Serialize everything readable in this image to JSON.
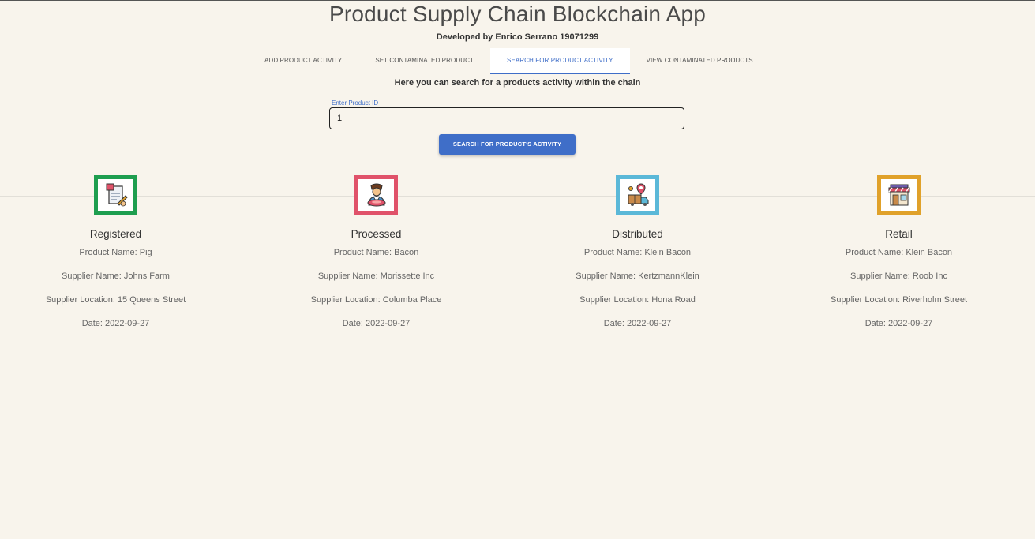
{
  "app": {
    "title": "Product Supply Chain Blockchain App",
    "subtitle": "Developed by Enrico Serrano 19071299"
  },
  "tabs": [
    {
      "label": "ADD PRODUCT ACTIVITY"
    },
    {
      "label": "SET CONTAMINATED PRODUCT"
    },
    {
      "label": "SEARCH FOR PRODUCT ACTIVITY",
      "active": true
    },
    {
      "label": "VIEW CONTAMINATED PRODUCTS"
    }
  ],
  "search": {
    "intro": "Here you can search for a products activity within the chain",
    "label": "Enter Product ID",
    "value": "1",
    "button_label": "SEARCH FOR PRODUCT'S ACTIVITY"
  },
  "colors": {
    "accent": "#3f6ec8",
    "registered": "#1e9e4f",
    "processed": "#e0526a",
    "distributed": "#5bb8d8",
    "retail": "#e0a12a"
  },
  "stages": [
    {
      "icon": "document-signing-icon",
      "title": "Registered",
      "product": "Product Name: Pig",
      "supplier": "Supplier Name: Johns Farm",
      "location": "Supplier Location: 15 Queens Street",
      "date": "Date: 2022-09-27"
    },
    {
      "icon": "butcher-icon",
      "title": "Processed",
      "product": "Product Name: Bacon",
      "supplier": "Supplier Name: Morissette Inc",
      "location": "Supplier Location: Columba Place",
      "date": "Date: 2022-09-27"
    },
    {
      "icon": "delivery-location-icon",
      "title": "Distributed",
      "product": "Product Name: Klein Bacon",
      "supplier": "Supplier Name: KertzmannKlein",
      "location": "Supplier Location: Hona Road",
      "date": "Date: 2022-09-27"
    },
    {
      "icon": "storefront-icon",
      "title": "Retail",
      "product": "Product Name: Klein Bacon",
      "supplier": "Supplier Name: Roob Inc",
      "location": "Supplier Location: Riverholm Street",
      "date": "Date: 2022-09-27"
    }
  ]
}
